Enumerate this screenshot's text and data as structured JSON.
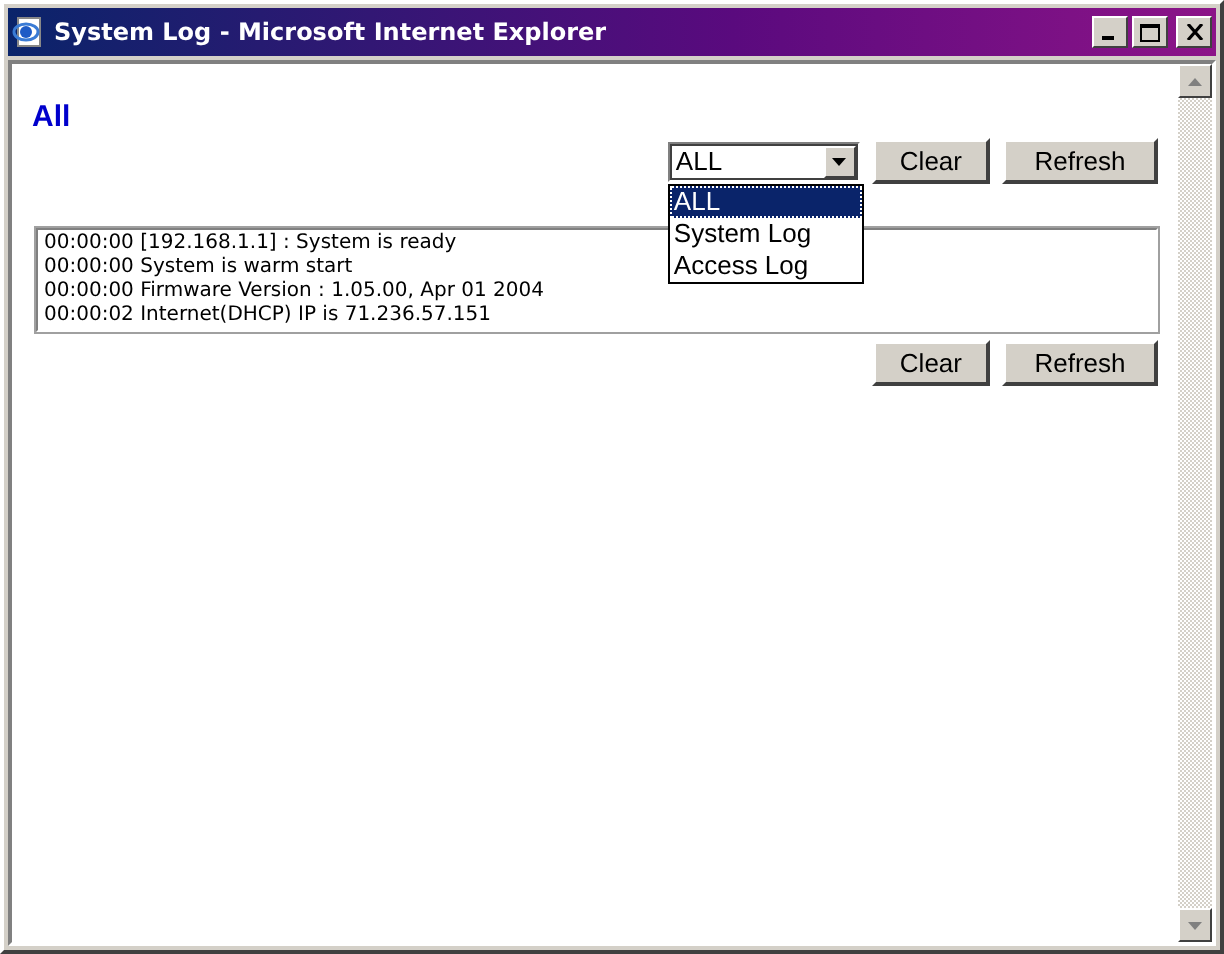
{
  "window": {
    "title": "System Log - Microsoft Internet Explorer"
  },
  "heading": "All",
  "filter": {
    "value": "ALL",
    "expanded": true,
    "options": [
      {
        "label": "ALL",
        "selected": true
      },
      {
        "label": "System Log",
        "selected": false
      },
      {
        "label": "Access Log",
        "selected": false
      }
    ]
  },
  "top_buttons": [
    "Clear",
    "Refresh"
  ],
  "log_lines": [
    "00:00:00 [192.168.1.1] : System is ready",
    "00:00:00 System is warm start",
    "00:00:00 Firmware Version : 1.05.00, Apr 01 2004",
    "00:00:02 Internet(DHCP) IP is 71.236.57.151"
  ],
  "bottom_buttons": [
    "Clear",
    "Refresh"
  ]
}
